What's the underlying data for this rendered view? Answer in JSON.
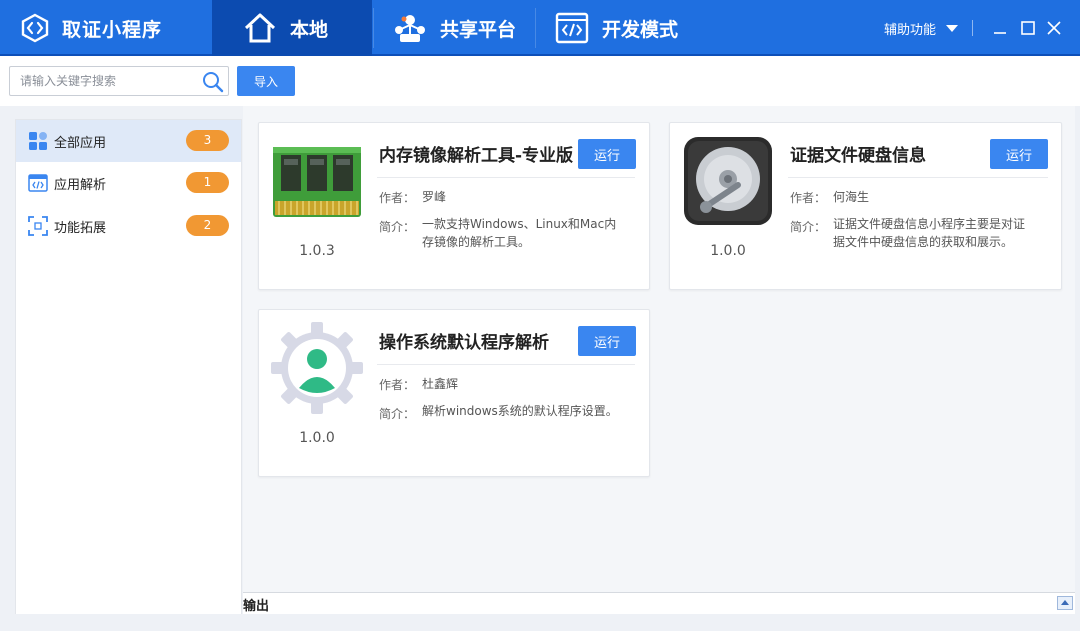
{
  "app": {
    "title": "取证小程序"
  },
  "nav": {
    "tabs": [
      {
        "label": "本地",
        "icon": "home-icon",
        "active": true
      },
      {
        "label": "共享平台",
        "icon": "share-network-icon",
        "active": false
      },
      {
        "label": "开发模式",
        "icon": "code-window-icon",
        "active": false
      }
    ],
    "assist_label": "辅助功能"
  },
  "toolbar": {
    "search_placeholder": "请输入关键字搜索",
    "import_label": "导入"
  },
  "sidebar": {
    "items": [
      {
        "label": "全部应用",
        "count": "3",
        "icon": "grid-apps-icon",
        "active": true
      },
      {
        "label": "应用解析",
        "count": "1",
        "icon": "code-window-icon",
        "active": false
      },
      {
        "label": "功能拓展",
        "count": "2",
        "icon": "expand-icon",
        "active": false
      }
    ]
  },
  "cards": [
    {
      "title": "内存镜像解析工具-专业版",
      "run_label": "运行",
      "author_label": "作者：",
      "author": "罗峰",
      "desc_label": "简介：",
      "desc_line1": "一款支持Windows、Linux和Mac内",
      "desc_line2": "存镜像的解析工具。",
      "version": "1.0.3",
      "icon": "memory-chip-icon"
    },
    {
      "title": "证据文件硬盘信息",
      "run_label": "运行",
      "author_label": "作者：",
      "author": "何海生",
      "desc_label": "简介：",
      "desc_line1": "证据文件硬盘信息小程序主要是对证",
      "desc_line2": "据文件中硬盘信息的获取和展示。",
      "version": "1.0.0",
      "icon": "hard-disk-icon"
    },
    {
      "title": "操作系统默认程序解析",
      "run_label": "运行",
      "author_label": "作者：",
      "author": "杜鑫辉",
      "desc_label": "简介：",
      "desc_line1": "解析windows系统的默认程序设置。",
      "desc_line2": "",
      "version": "1.0.0",
      "icon": "user-gear-icon"
    }
  ],
  "output": {
    "label": "输出"
  },
  "colors": {
    "titlebar": "#1f6fe0",
    "active_tab": "#0c4bb0",
    "accent": "#3a86f0",
    "badge": "#f19833"
  }
}
